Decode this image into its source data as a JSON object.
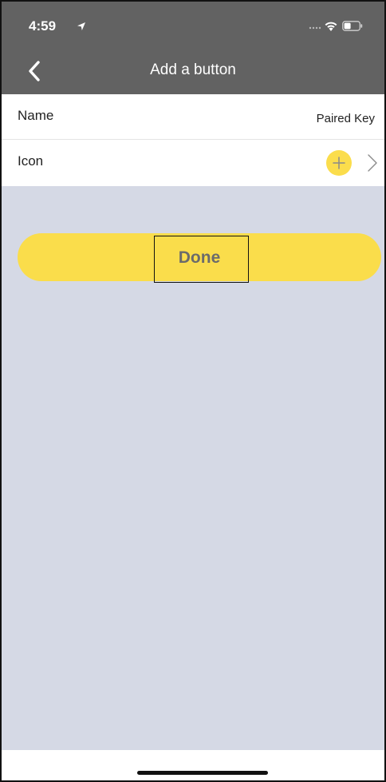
{
  "status_bar": {
    "time": "4:59",
    "location_icon": "location-arrow-icon",
    "wifi_icon": "wifi-icon",
    "battery_icon": "battery-icon"
  },
  "nav": {
    "title": "Add a button",
    "back_icon": "chevron-left-icon"
  },
  "form": {
    "rows": [
      {
        "label": "Name",
        "value": "Paired Key"
      },
      {
        "label": "Icon",
        "icon": "plus-icon",
        "chevron": "chevron-right-icon"
      }
    ]
  },
  "done_button": {
    "label": "Done"
  },
  "colors": {
    "header": "#626262",
    "accent_yellow": "#fadd4b",
    "background": "#d5d9e5",
    "row_background": "#ffffff",
    "done_text": "#6b6b6b"
  }
}
